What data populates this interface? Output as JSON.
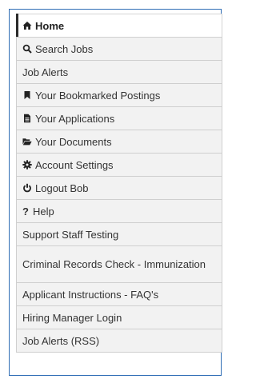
{
  "colors": {
    "frame_border": "#2f6db5",
    "item_bg": "#f2f2f2",
    "active_bg": "#ffffff",
    "text": "#333333"
  },
  "menu": {
    "items": [
      {
        "label": "Home",
        "icon": "home-icon",
        "active": true
      },
      {
        "label": "Search Jobs",
        "icon": "search-icon"
      },
      {
        "label": "Job Alerts"
      },
      {
        "label": "Your Bookmarked Postings",
        "icon": "bookmark-icon"
      },
      {
        "label": "Your Applications",
        "icon": "file-icon"
      },
      {
        "label": "Your Documents",
        "icon": "folder-open-icon"
      },
      {
        "label": "Account Settings",
        "icon": "gear-icon"
      },
      {
        "label": "Logout Bob",
        "icon": "power-icon"
      },
      {
        "label": "Help",
        "icon": "question-icon",
        "glyph": "?"
      },
      {
        "label": "Support Staff Testing"
      },
      {
        "label": "Criminal Records Check - Immunization"
      },
      {
        "label": "Applicant Instructions - FAQ's"
      },
      {
        "label": "Hiring Manager Login"
      },
      {
        "label": "Job Alerts (RSS)"
      }
    ]
  }
}
